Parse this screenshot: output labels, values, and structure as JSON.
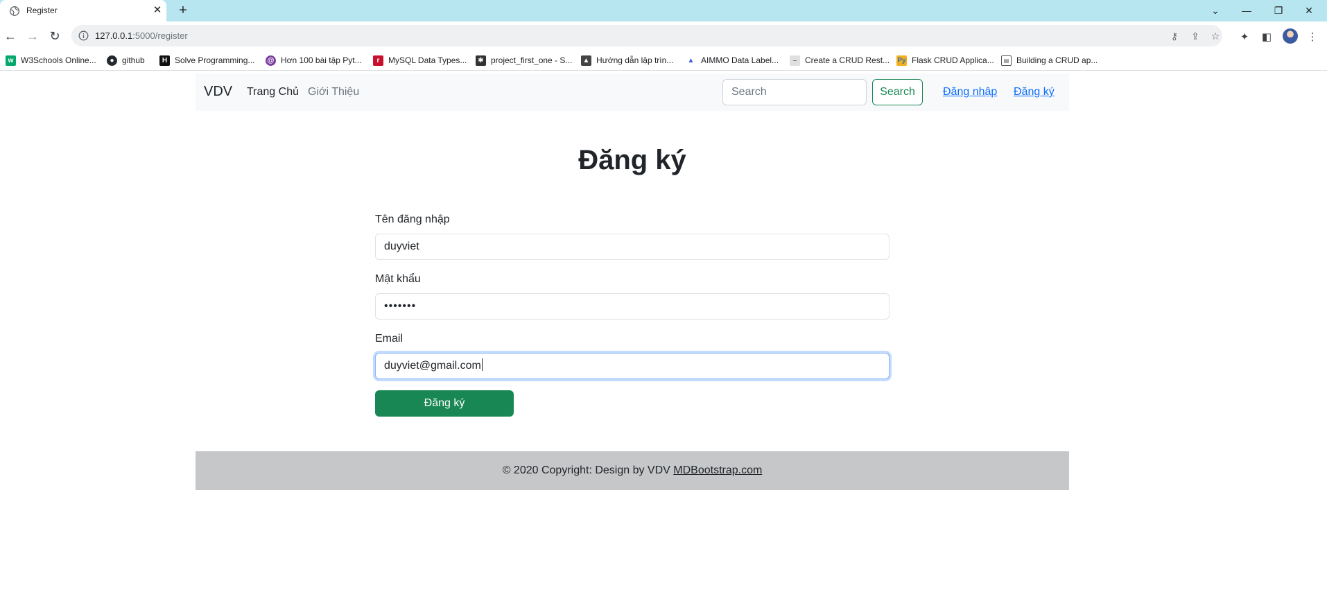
{
  "browser": {
    "tab_title": "Register",
    "url_host": "127.0.0.1",
    "url_path": ":5000/register",
    "bookmarks": [
      {
        "label": "W3Schools Online...",
        "color": "#04aa6d",
        "icon": "w3schools-icon"
      },
      {
        "label": "github",
        "color": "#24292f",
        "icon": "github-icon"
      },
      {
        "label": "Solve Programming...",
        "color": "#111111",
        "icon": "hackerrank-icon"
      },
      {
        "label": "Hơn 100 bài tập Pyt...",
        "color": "#7b3fa0",
        "icon": "bookmark-icon"
      },
      {
        "label": "MySQL Data Types...",
        "color": "#c8102e",
        "icon": "bookmark-icon"
      },
      {
        "label": "project_first_one - S...",
        "color": "#333333",
        "icon": "bookmark-icon"
      },
      {
        "label": "Hướng dẫn lập trìn...",
        "color": "#444444",
        "icon": "bookmark-icon"
      },
      {
        "label": "AIMMO Data Label...",
        "color": "#3a5bd9",
        "icon": "bookmark-icon"
      },
      {
        "label": "Create a CRUD Rest...",
        "color": "#bdbdbd",
        "icon": "bookmark-icon"
      },
      {
        "label": "Flask CRUD Applica...",
        "color": "#f2b01e",
        "icon": "bookmark-icon"
      },
      {
        "label": "Building a CRUD ap...",
        "color": "#555555",
        "icon": "bookmark-icon"
      }
    ]
  },
  "navbar": {
    "brand": "VDV",
    "links": [
      "Trang Chủ",
      "Giới Thiệu"
    ],
    "search_placeholder": "Search",
    "search_button": "Search",
    "login": "Đăng nhập",
    "register": "Đăng ký"
  },
  "form": {
    "heading": "Đăng ký",
    "username_label": "Tên đăng nhập",
    "username_value": "duyviet",
    "password_label": "Mật khẩu",
    "password_value": "•••••••",
    "email_label": "Email",
    "email_value": "duyviet@gmail.com",
    "submit_label": "Đăng ký"
  },
  "footer": {
    "text": "© 2020 Copyright: Design by VDV ",
    "link": "MDBootstrap.com"
  },
  "colors": {
    "primary_link": "#0d6efd",
    "success": "#198754",
    "tabbar": "#b8e6f0"
  }
}
